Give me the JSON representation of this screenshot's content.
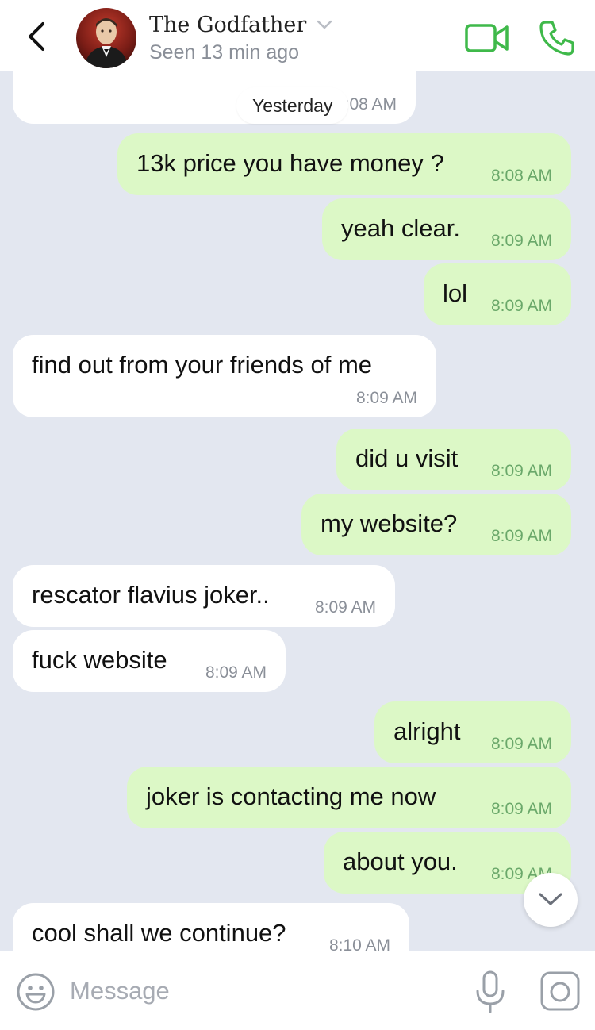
{
  "header": {
    "contact_name": "The Godfather",
    "status": "Seen 13 min ago",
    "icons": [
      "back-chevron-icon",
      "chevron-down-icon",
      "video-camera-icon",
      "phone-icon"
    ],
    "accent_color": "#3fb94a"
  },
  "chat": {
    "date_pill": "Yesterday",
    "partial_top_time": "8:08 AM",
    "messages": [
      {
        "dir": "out",
        "text": "13k price you have money ?",
        "time": "8:08 AM"
      },
      {
        "dir": "out",
        "text": "yeah clear.",
        "time": "8:09 AM"
      },
      {
        "dir": "out",
        "text": "lol",
        "time": "8:09 AM"
      },
      {
        "dir": "in",
        "text": "find out from your friends of me",
        "time": "8:09 AM"
      },
      {
        "dir": "out",
        "text": "did u visit",
        "time": "8:09 AM"
      },
      {
        "dir": "out",
        "text": "my website?",
        "time": "8:09 AM"
      },
      {
        "dir": "in",
        "text": "rescator flavius joker..",
        "time": "8:09 AM"
      },
      {
        "dir": "in",
        "text": "fuck website",
        "time": "8:09 AM"
      },
      {
        "dir": "out",
        "text": "alright",
        "time": "8:09 AM"
      },
      {
        "dir": "out",
        "text": "joker is contacting me now",
        "time": "8:09 AM"
      },
      {
        "dir": "out",
        "text": "about you.",
        "time": "8:09 AM"
      },
      {
        "dir": "in",
        "text": "cool shall we continue?",
        "time": "8:10 AM"
      }
    ],
    "outgoing_color": "#dcf8c6",
    "incoming_color": "#ffffff",
    "background_color": "#e3e7f0"
  },
  "composer": {
    "placeholder": "Message",
    "icons": [
      "emoji-icon",
      "microphone-icon",
      "camera-icon"
    ]
  }
}
